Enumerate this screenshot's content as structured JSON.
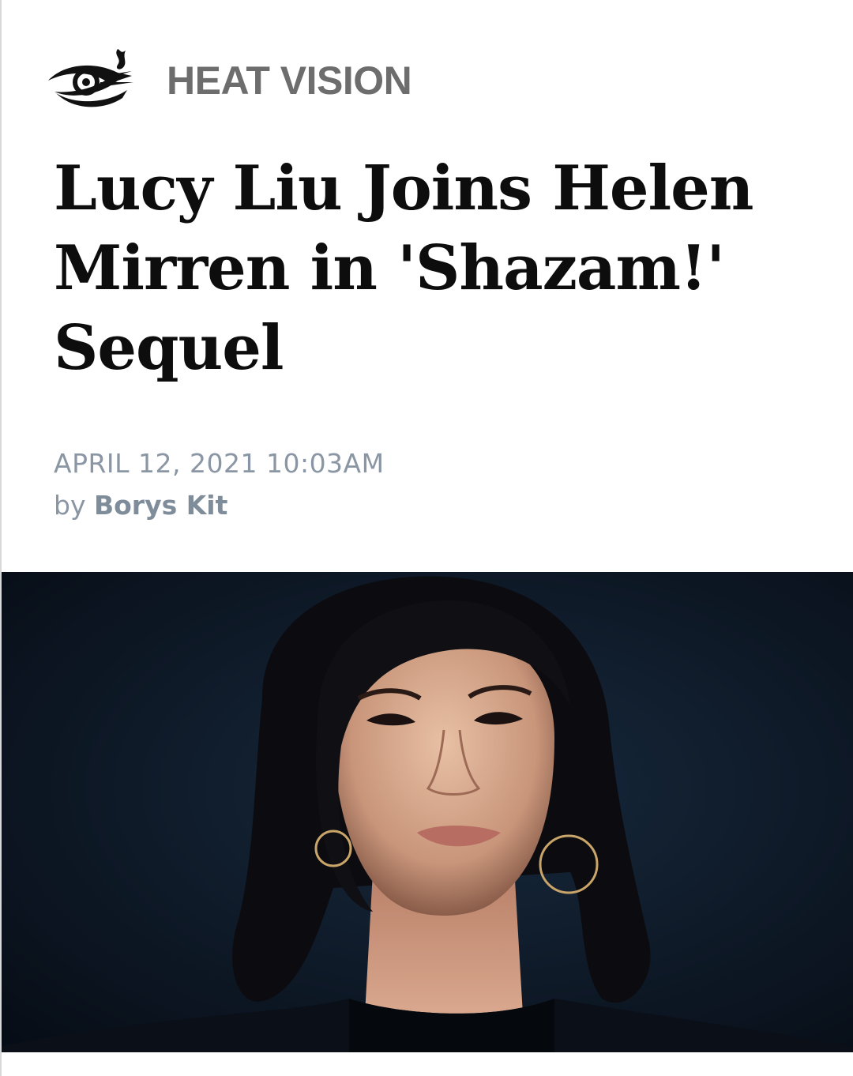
{
  "section": {
    "label": "HEAT VISION",
    "logo_icon": "heat-vision-eye-icon"
  },
  "article": {
    "headline": "Lucy Liu Joins Helen Mirren in 'Shazam!' Sequel",
    "date": "APRIL 12, 2021 10:03AM",
    "byline_prefix": "by",
    "author": "Borys Kit"
  },
  "hero_image": {
    "subject": "portrait-photo"
  },
  "colors": {
    "section_label": "#6d6d6d",
    "headline": "#0d0d0d",
    "meta": "#8a96a3",
    "hero_background": "#0b1420"
  }
}
